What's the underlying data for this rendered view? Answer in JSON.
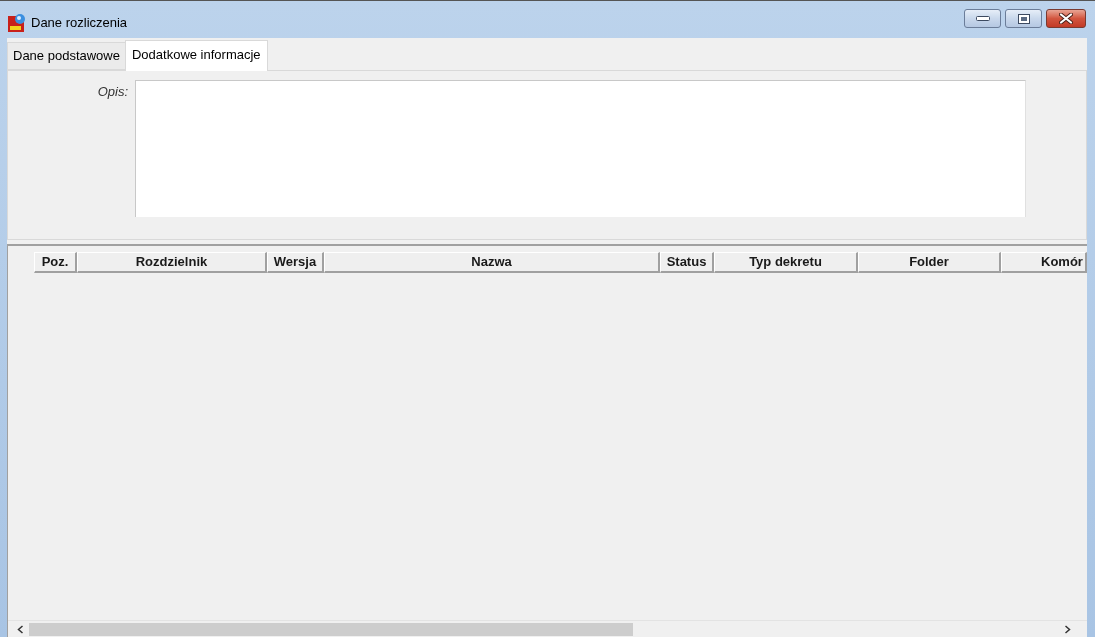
{
  "window": {
    "title": "Dane rozliczenia"
  },
  "tabs": [
    {
      "label": "Dane podstawowe",
      "selected": false
    },
    {
      "label": "Dodatkowe informacje",
      "selected": true
    }
  ],
  "form": {
    "description_label": "Opis:"
  },
  "grid": {
    "columns": [
      "Poz.",
      "Rozdzielnik",
      "Wersja",
      "Nazwa",
      "Status",
      "Typ dekretu",
      "Folder",
      "Komór"
    ]
  }
}
